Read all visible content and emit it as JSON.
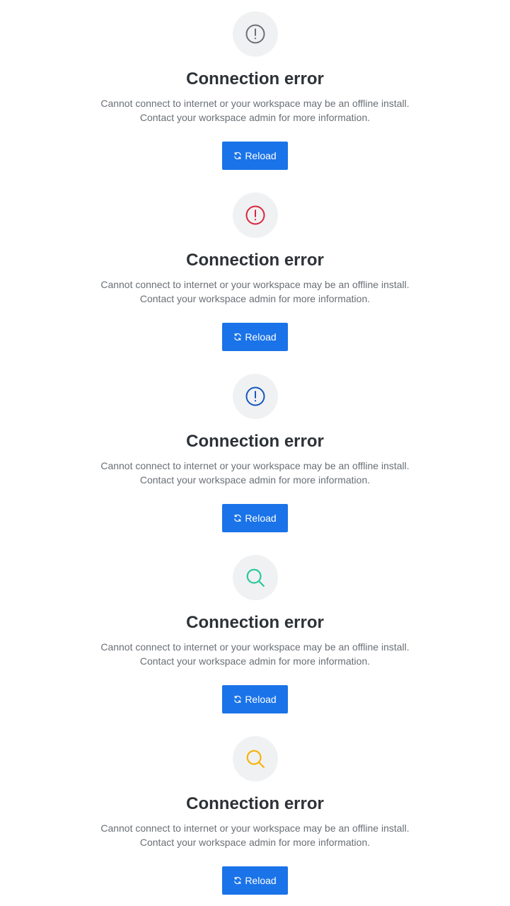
{
  "states": [
    {
      "icon": "alert-circle-icon",
      "icon_color": "#6b7075",
      "title": "Connection error",
      "line1": "Cannot connect to internet or your workspace may be an offline install.",
      "line2": "Contact your workspace admin for more information.",
      "button_label": "Reload"
    },
    {
      "icon": "alert-circle-icon",
      "icon_color": "#d7263d",
      "title": "Connection error",
      "line1": "Cannot connect to internet or your workspace may be an offline install.",
      "line2": "Contact your workspace admin for more information.",
      "button_label": "Reload"
    },
    {
      "icon": "alert-circle-icon",
      "icon_color": "#1557c0",
      "title": "Connection error",
      "line1": "Cannot connect to internet or your workspace may be an offline install.",
      "line2": "Contact your workspace admin for more information.",
      "button_label": "Reload"
    },
    {
      "icon": "search-icon",
      "icon_color": "#2ec89a",
      "title": "Connection error",
      "line1": "Cannot connect to internet or your workspace may be an offline install.",
      "line2": "Contact your workspace admin for more information.",
      "button_label": "Reload"
    },
    {
      "icon": "search-icon",
      "icon_color": "#f5b50a",
      "title": "Connection error",
      "line1": "Cannot connect to internet or your workspace may be an offline install.",
      "line2": "Contact your workspace admin for more information.",
      "button_label": "Reload"
    }
  ],
  "colors": {
    "button_bg": "#1a73e8",
    "icon_circle_bg": "#f0f1f3",
    "title_text": "#2d3237",
    "body_text": "#6a6f75"
  }
}
